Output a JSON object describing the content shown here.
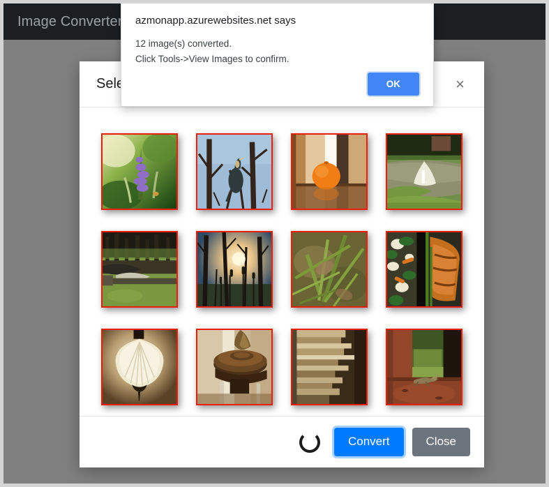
{
  "navbar": {
    "brand": "Image Converter"
  },
  "modal": {
    "title": "Select Images",
    "close_icon_label": "×",
    "footer": {
      "convert_label": "Convert",
      "close_label": "Close",
      "spinner_visible": true
    },
    "thumbnails": [
      {
        "name": "purple-flower-spike",
        "alt": "Purple lavender flower spike on green foliage"
      },
      {
        "name": "heron-in-tree",
        "alt": "Heron perched in bare tree branches against blue sky"
      },
      {
        "name": "orange-fruit",
        "alt": "Orange fruit on reflective surface indoors"
      },
      {
        "name": "pond-fountain",
        "alt": "Water fountain in a pond with green grass"
      },
      {
        "name": "forest-pond",
        "alt": "Pond in a forest clearing with bare trees"
      },
      {
        "name": "sunset-through-trees",
        "alt": "Sunset glowing through trees with cattails"
      },
      {
        "name": "grass-closeup",
        "alt": "Close-up of grass blades and dry leaves"
      },
      {
        "name": "grilled-salmon-plate",
        "alt": "Grilled salmon with vegetables on a dark plate"
      },
      {
        "name": "pendant-lamp",
        "alt": "Cream colored pendant ceiling lamp"
      },
      {
        "name": "wooden-banister",
        "alt": "Wooden stair banister newel post"
      },
      {
        "name": "stacked-books",
        "alt": "Stack of books seen edge on"
      },
      {
        "name": "lizard-by-pillar",
        "alt": "Lizard on ledge beside a red pillar with grass beyond"
      }
    ],
    "selection_border_color": "#e81f00"
  },
  "alert": {
    "origin": "azmonapp.azurewebsites.net says",
    "message_lines": [
      "12 image(s) converted.",
      "Click Tools->View Images to confirm."
    ],
    "ok_label": "OK"
  },
  "colors": {
    "navbar_bg": "#1b1f22",
    "backdrop": "#808080",
    "primary_button": "#007bff",
    "secondary_button": "#6c757d",
    "alert_button": "#4285f4",
    "selection_border": "#e81f00"
  }
}
